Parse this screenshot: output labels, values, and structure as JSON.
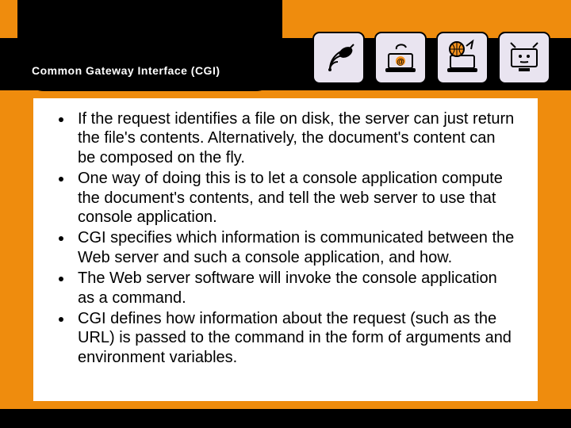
{
  "header": {
    "title": "Common Gateway Interface (CGI)"
  },
  "icons": [
    {
      "name": "satellite-icon"
    },
    {
      "name": "laptop-email-icon"
    },
    {
      "name": "globe-laptop-icon"
    },
    {
      "name": "surveillance-monitor-icon"
    }
  ],
  "bullets": [
    "If the request identifies a file on disk, the server can just return the file's contents. Alternatively, the document's content can be composed on the fly.",
    "One way of doing this is to let a console application compute the document's contents, and tell the web server to use that console application.",
    "CGI specifies which information is communicated between the Web server and such a console application, and how.",
    "The Web server software will invoke the console application as a command.",
    "CGI defines how information about the request (such as the URL) is passed to the command in the form of arguments and environment variables."
  ]
}
